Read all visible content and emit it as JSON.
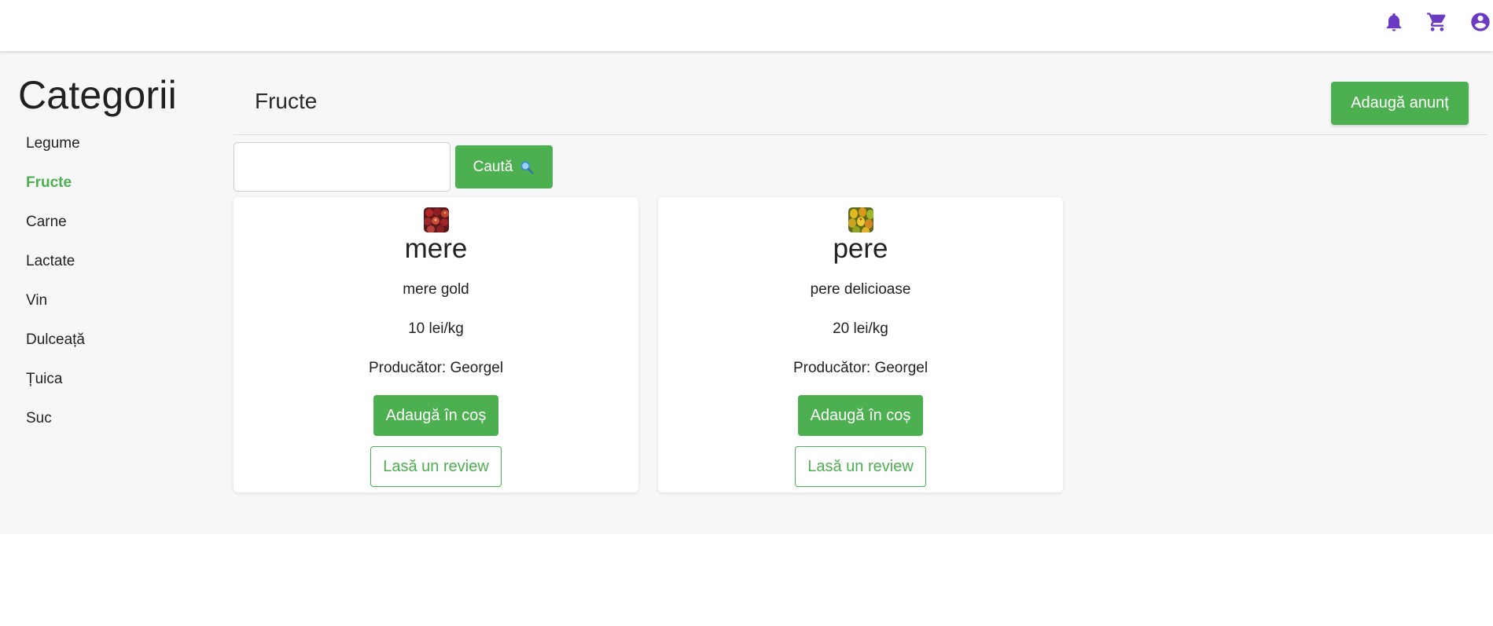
{
  "topbar": {
    "icons": [
      "bell-icon",
      "shopping-cart-icon",
      "account-circle-icon"
    ],
    "icon_color": "#6a3bc2"
  },
  "sidebar": {
    "title": "Categorii",
    "items": [
      {
        "label": "Legume",
        "active": false
      },
      {
        "label": "Fructe",
        "active": true
      },
      {
        "label": "Carne",
        "active": false
      },
      {
        "label": "Lactate",
        "active": false
      },
      {
        "label": "Vin",
        "active": false
      },
      {
        "label": "Dulceață",
        "active": false
      },
      {
        "label": "Țuica",
        "active": false
      },
      {
        "label": "Suc",
        "active": false
      }
    ]
  },
  "main": {
    "title": "Fructe",
    "add_button_label": "Adaugă anunț",
    "search": {
      "value": "",
      "placeholder": "",
      "button_label": "Caută",
      "button_icon": "magnifier-icon"
    },
    "products": [
      {
        "image": "apples-thumbnail",
        "name": "mere",
        "description": "mere gold",
        "price": "10 lei/kg",
        "producer": "Producător: Georgel",
        "cart_label": "Adaugă în coș",
        "review_label": "Lasă un review"
      },
      {
        "image": "pears-thumbnail",
        "name": "pere",
        "description": "pere delicioase",
        "price": "20 lei/kg",
        "producer": "Producător: Georgel",
        "cart_label": "Adaugă în coș",
        "review_label": "Lasă un review"
      }
    ]
  },
  "colors": {
    "accent": "#4caf50",
    "icon": "#6a3bc2",
    "background": "#f7f7f7"
  }
}
